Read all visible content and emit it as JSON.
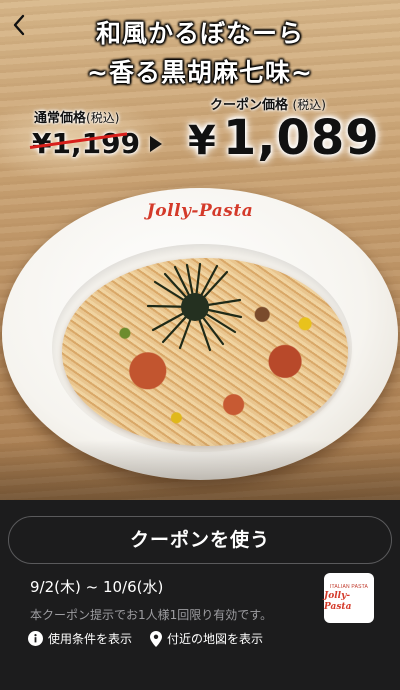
{
  "header": {
    "back_icon": "chevron-left-icon",
    "title_line1": "和風かるぼなーら",
    "title_line2": "~香る黒胡麻七味~"
  },
  "pricing": {
    "regular_label": "通常価格",
    "regular_label_tax": "(税込)",
    "regular_price": "¥1,199",
    "coupon_label": "クーポン価格",
    "coupon_label_tax": "(税込)",
    "coupon_price_symbol": "¥",
    "coupon_price_value": "1,089"
  },
  "image": {
    "plate_logo": "Jolly-Pasta"
  },
  "footer": {
    "use_button_label": "クーポンを使う",
    "validity": "9/2(木) ~ 10/6(水)",
    "note": "本クーポン提示でお1人様1回限り有効です。",
    "terms_link": "使用条件を表示",
    "map_link": "付近の地図を表示",
    "brand_logo_arc": "ITALIAN PASTA",
    "brand_logo_word": "Jolly-Pasta"
  },
  "colors": {
    "panel_bg": "#1c1c1d",
    "strike_red": "#d8201c",
    "brand_red": "#d43a2a",
    "note_gray": "#9e9ea2"
  }
}
